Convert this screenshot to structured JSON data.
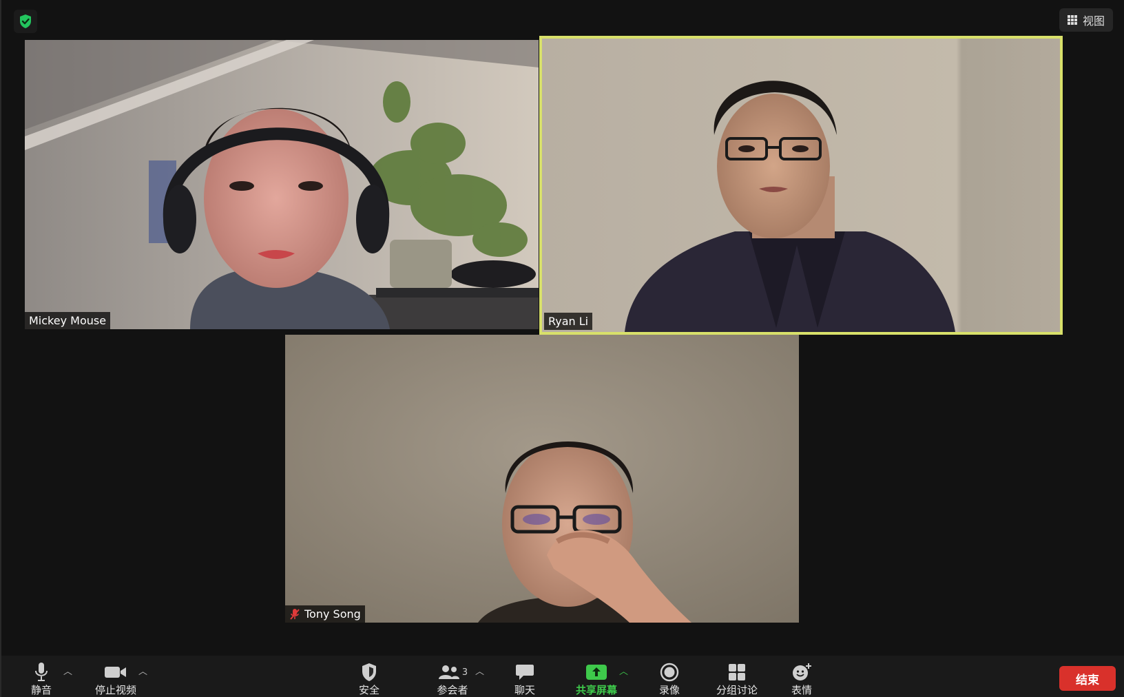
{
  "header": {
    "view_label": "视图"
  },
  "participants": [
    {
      "name": "Mickey Mouse",
      "muted": false,
      "active_speaker": false
    },
    {
      "name": "Ryan Li",
      "muted": false,
      "active_speaker": true
    },
    {
      "name": "Tony Song",
      "muted": true,
      "active_speaker": false
    }
  ],
  "toolbar": {
    "mute_label": "静音",
    "stop_video_label": "停止视频",
    "security_label": "安全",
    "participants_label": "参会者",
    "participants_count": "3",
    "chat_label": "聊天",
    "share_screen_label": "共享屏幕",
    "record_label": "录像",
    "breakout_label": "分组讨论",
    "reactions_label": "表情",
    "end_label": "结束"
  },
  "colors": {
    "active_speaker_border": "#d8e06a",
    "share_green": "#3ec94b",
    "end_red": "#d9312b",
    "background": "#121212"
  }
}
